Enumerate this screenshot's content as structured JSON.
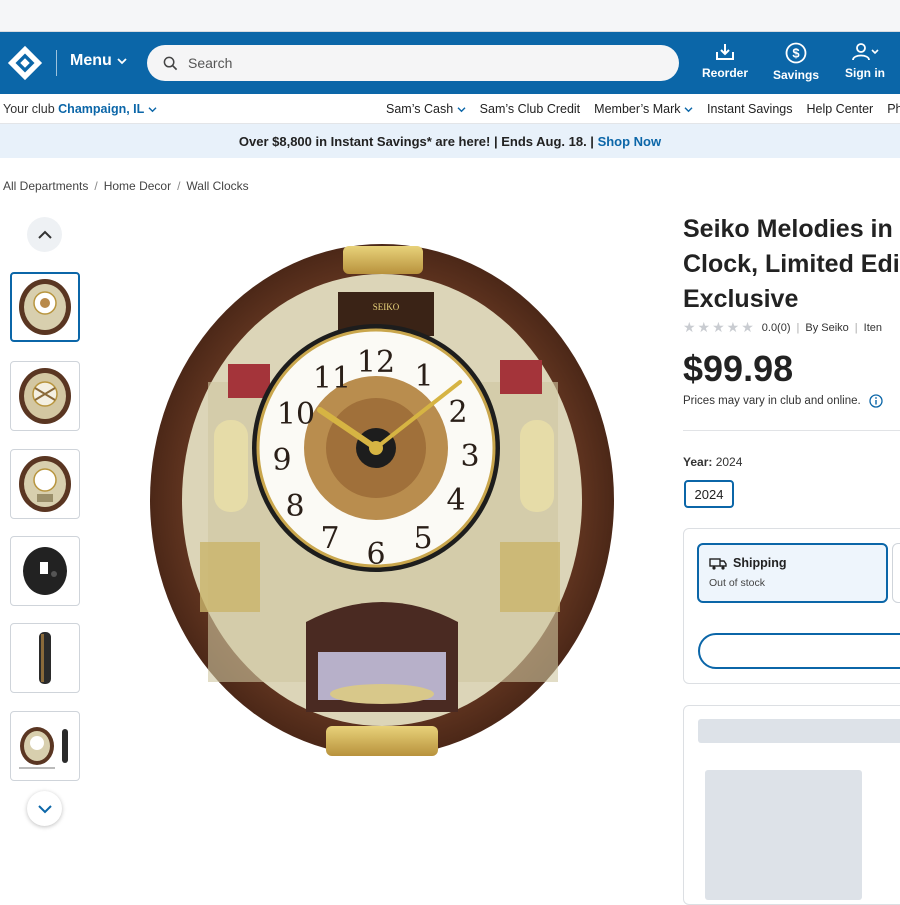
{
  "header": {
    "menu_label": "Menu",
    "search_placeholder": "Search",
    "actions": [
      {
        "label": "Reorder",
        "icon": "reorder-icon"
      },
      {
        "label": "Savings",
        "icon": "dollar-icon"
      },
      {
        "label": "Sign in",
        "icon": "person-icon"
      }
    ],
    "brand_color": "#0b66a8"
  },
  "subbar": {
    "club_prefix": "Your club",
    "club_name": "Champaign, IL",
    "links": [
      "Sam’s Cash",
      "Sam’s Club Credit",
      "Member’s Mark",
      "Instant Savings",
      "Help Center",
      "Pharmac"
    ]
  },
  "promo": {
    "text": "Over $8,800 in Instant Savings* are here! | Ends Aug. 18. |",
    "link": "Shop Now"
  },
  "breadcrumb": [
    "All Departments",
    "Home Decor",
    "Wall Clocks"
  ],
  "product": {
    "title_lines": [
      "Seiko Melodies in M",
      "Clock, Limited Editi",
      "Exclusive"
    ],
    "rating_value": "0.0(0)",
    "brand": "By Seiko",
    "item_fragment": "Iten",
    "price": "$99.98",
    "price_note": "Prices may vary in club and online.",
    "year_label": "Year:",
    "year_value": "2024",
    "year_chip": "2024",
    "shipping_title": "Shipping",
    "shipping_status": "Out of stock"
  },
  "gallery": {
    "thumbnails": [
      "thumbnail-front",
      "thumbnail-open-front",
      "thumbnail-front-alt",
      "thumbnail-back",
      "thumbnail-side",
      "thumbnail-dimensions"
    ]
  }
}
